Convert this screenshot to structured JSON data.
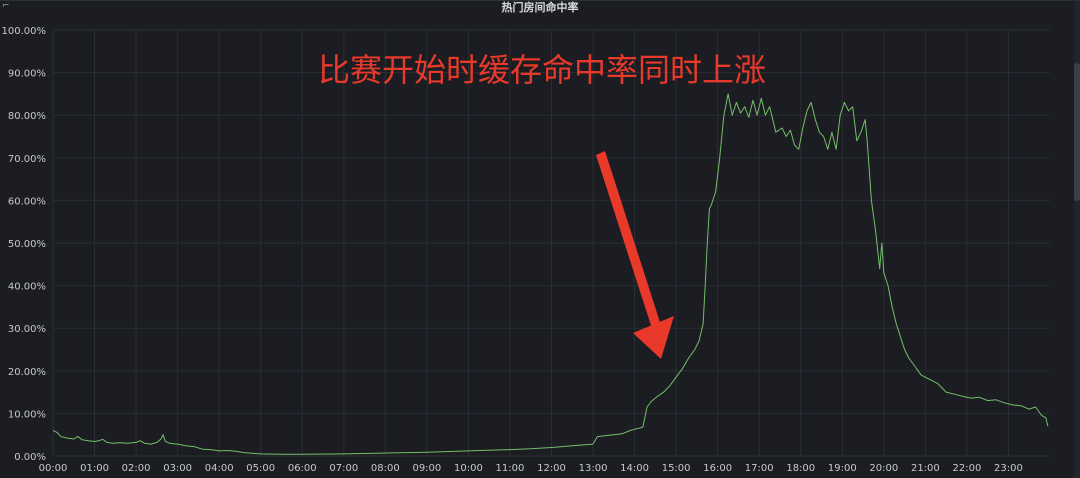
{
  "panel": {
    "title": "热门房间命中率"
  },
  "chart_data": {
    "type": "line",
    "title": "热门房间命中率",
    "xlabel": "",
    "ylabel": "",
    "x_ticks": [
      "00:00",
      "01:00",
      "02:00",
      "03:00",
      "04:00",
      "05:00",
      "06:00",
      "07:00",
      "08:00",
      "09:00",
      "10:00",
      "11:00",
      "12:00",
      "13:00",
      "14:00",
      "15:00",
      "16:00",
      "17:00",
      "18:00",
      "19:00",
      "20:00",
      "21:00",
      "22:00",
      "23:00"
    ],
    "y_ticks": [
      "0.00%",
      "10.00%",
      "20.00%",
      "30.00%",
      "40.00%",
      "50.00%",
      "60.00%",
      "70.00%",
      "80.00%",
      "90.00%",
      "100.00%"
    ],
    "ylim": [
      0,
      100
    ],
    "xlim": [
      0,
      24
    ],
    "grid": true,
    "series": [
      {
        "color": "#73bf69",
        "points": [
          [
            0.0,
            6.0
          ],
          [
            0.1,
            5.5
          ],
          [
            0.2,
            4.5
          ],
          [
            0.35,
            4.2
          ],
          [
            0.5,
            4.0
          ],
          [
            0.6,
            4.6
          ],
          [
            0.7,
            3.8
          ],
          [
            0.85,
            3.6
          ],
          [
            1.0,
            3.4
          ],
          [
            1.1,
            3.6
          ],
          [
            1.2,
            3.9
          ],
          [
            1.3,
            3.2
          ],
          [
            1.45,
            3.0
          ],
          [
            1.6,
            3.1
          ],
          [
            1.8,
            3.0
          ],
          [
            2.0,
            3.2
          ],
          [
            2.1,
            3.6
          ],
          [
            2.2,
            3.0
          ],
          [
            2.35,
            2.8
          ],
          [
            2.5,
            3.2
          ],
          [
            2.6,
            4.0
          ],
          [
            2.65,
            5.0
          ],
          [
            2.7,
            3.5
          ],
          [
            2.8,
            3.0
          ],
          [
            3.0,
            2.8
          ],
          [
            3.2,
            2.4
          ],
          [
            3.4,
            2.2
          ],
          [
            3.6,
            1.6
          ],
          [
            3.8,
            1.5
          ],
          [
            4.0,
            1.2
          ],
          [
            4.2,
            1.3
          ],
          [
            4.4,
            1.1
          ],
          [
            4.6,
            0.8
          ],
          [
            5.0,
            0.5
          ],
          [
            5.5,
            0.4
          ],
          [
            6.0,
            0.4
          ],
          [
            7.0,
            0.5
          ],
          [
            8.0,
            0.7
          ],
          [
            9.0,
            0.9
          ],
          [
            10.0,
            1.2
          ],
          [
            11.0,
            1.5
          ],
          [
            11.5,
            1.7
          ],
          [
            12.0,
            2.0
          ],
          [
            12.5,
            2.4
          ],
          [
            13.0,
            2.8
          ],
          [
            13.1,
            4.5
          ],
          [
            13.3,
            4.8
          ],
          [
            13.5,
            5.0
          ],
          [
            13.7,
            5.2
          ],
          [
            13.9,
            6.0
          ],
          [
            14.0,
            6.3
          ],
          [
            14.1,
            6.5
          ],
          [
            14.2,
            6.8
          ],
          [
            14.3,
            11.5
          ],
          [
            14.4,
            12.8
          ],
          [
            14.55,
            14.0
          ],
          [
            14.7,
            15.0
          ],
          [
            14.85,
            16.5
          ],
          [
            15.0,
            18.5
          ],
          [
            15.15,
            20.5
          ],
          [
            15.3,
            23.0
          ],
          [
            15.45,
            25.0
          ],
          [
            15.55,
            27.0
          ],
          [
            15.65,
            31.0
          ],
          [
            15.7,
            40.0
          ],
          [
            15.75,
            50.0
          ],
          [
            15.8,
            58.0
          ],
          [
            15.85,
            59.0
          ],
          [
            15.95,
            62.0
          ],
          [
            16.05,
            70.0
          ],
          [
            16.15,
            80.0
          ],
          [
            16.25,
            85.0
          ],
          [
            16.35,
            80.0
          ],
          [
            16.45,
            83.0
          ],
          [
            16.55,
            80.5
          ],
          [
            16.65,
            82.0
          ],
          [
            16.75,
            79.5
          ],
          [
            16.85,
            83.5
          ],
          [
            16.95,
            80.0
          ],
          [
            17.05,
            84.0
          ],
          [
            17.15,
            80.0
          ],
          [
            17.25,
            82.0
          ],
          [
            17.4,
            76.0
          ],
          [
            17.55,
            77.0
          ],
          [
            17.65,
            75.0
          ],
          [
            17.75,
            76.5
          ],
          [
            17.85,
            73.0
          ],
          [
            17.95,
            72.0
          ],
          [
            18.05,
            77.0
          ],
          [
            18.15,
            81.0
          ],
          [
            18.25,
            83.0
          ],
          [
            18.35,
            79.0
          ],
          [
            18.45,
            76.0
          ],
          [
            18.55,
            75.0
          ],
          [
            18.65,
            72.0
          ],
          [
            18.75,
            76.0
          ],
          [
            18.85,
            72.0
          ],
          [
            18.95,
            80.0
          ],
          [
            19.05,
            83.0
          ],
          [
            19.15,
            81.0
          ],
          [
            19.25,
            82.0
          ],
          [
            19.35,
            74.0
          ],
          [
            19.45,
            76.0
          ],
          [
            19.55,
            79.0
          ],
          [
            19.6,
            74.0
          ],
          [
            19.7,
            60.0
          ],
          [
            19.8,
            53.0
          ],
          [
            19.9,
            44.0
          ],
          [
            19.95,
            50.0
          ],
          [
            20.0,
            43.0
          ],
          [
            20.1,
            40.0
          ],
          [
            20.2,
            35.0
          ],
          [
            20.3,
            31.0
          ],
          [
            20.4,
            28.0
          ],
          [
            20.5,
            25.0
          ],
          [
            20.6,
            23.0
          ],
          [
            20.75,
            21.0
          ],
          [
            20.9,
            19.0
          ],
          [
            21.1,
            18.0
          ],
          [
            21.3,
            17.0
          ],
          [
            21.5,
            15.0
          ],
          [
            21.7,
            14.5
          ],
          [
            21.9,
            14.0
          ],
          [
            22.1,
            13.6
          ],
          [
            22.3,
            13.8
          ],
          [
            22.5,
            13.0
          ],
          [
            22.7,
            13.2
          ],
          [
            22.9,
            12.5
          ],
          [
            23.1,
            12.0
          ],
          [
            23.3,
            11.8
          ],
          [
            23.5,
            11.0
          ],
          [
            23.65,
            11.5
          ],
          [
            23.8,
            9.5
          ],
          [
            23.9,
            9.0
          ],
          [
            23.95,
            7.0
          ]
        ]
      }
    ],
    "annotation": {
      "text": "比赛开始时缓存命中率同时上涨",
      "color": "#e8392b"
    }
  }
}
